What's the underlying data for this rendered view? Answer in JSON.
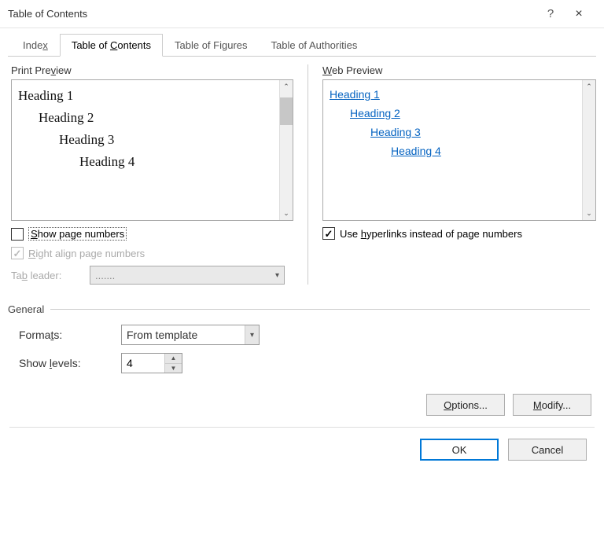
{
  "dialog": {
    "title": "Table of Contents",
    "help_symbol": "?",
    "close_symbol": "×"
  },
  "tabs": {
    "index": "Index",
    "toc": "Table of Contents",
    "tof": "Table of Figures",
    "toa": "Table of Authorities",
    "active": "toc"
  },
  "print_preview": {
    "label": "Print Preview",
    "items": [
      "Heading 1",
      "Heading 2",
      "Heading 3",
      "Heading 4"
    ]
  },
  "web_preview": {
    "label": "Web Preview",
    "items": [
      "Heading 1",
      "Heading 2",
      "Heading 3",
      "Heading 4"
    ]
  },
  "options": {
    "show_page_numbers": {
      "label": "Show page numbers",
      "checked": false
    },
    "right_align": {
      "label": "Right align page numbers",
      "checked": true,
      "disabled": true
    },
    "tab_leader": {
      "label": "Tab leader:",
      "value": "......."
    },
    "use_hyperlinks": {
      "label": "Use hyperlinks instead of page numbers",
      "checked": true
    }
  },
  "general": {
    "legend": "General",
    "formats_label": "Formats:",
    "formats_value": "From template",
    "levels_label": "Show levels:",
    "levels_value": "4"
  },
  "buttons": {
    "options": "Options...",
    "modify": "Modify...",
    "ok": "OK",
    "cancel": "Cancel"
  }
}
